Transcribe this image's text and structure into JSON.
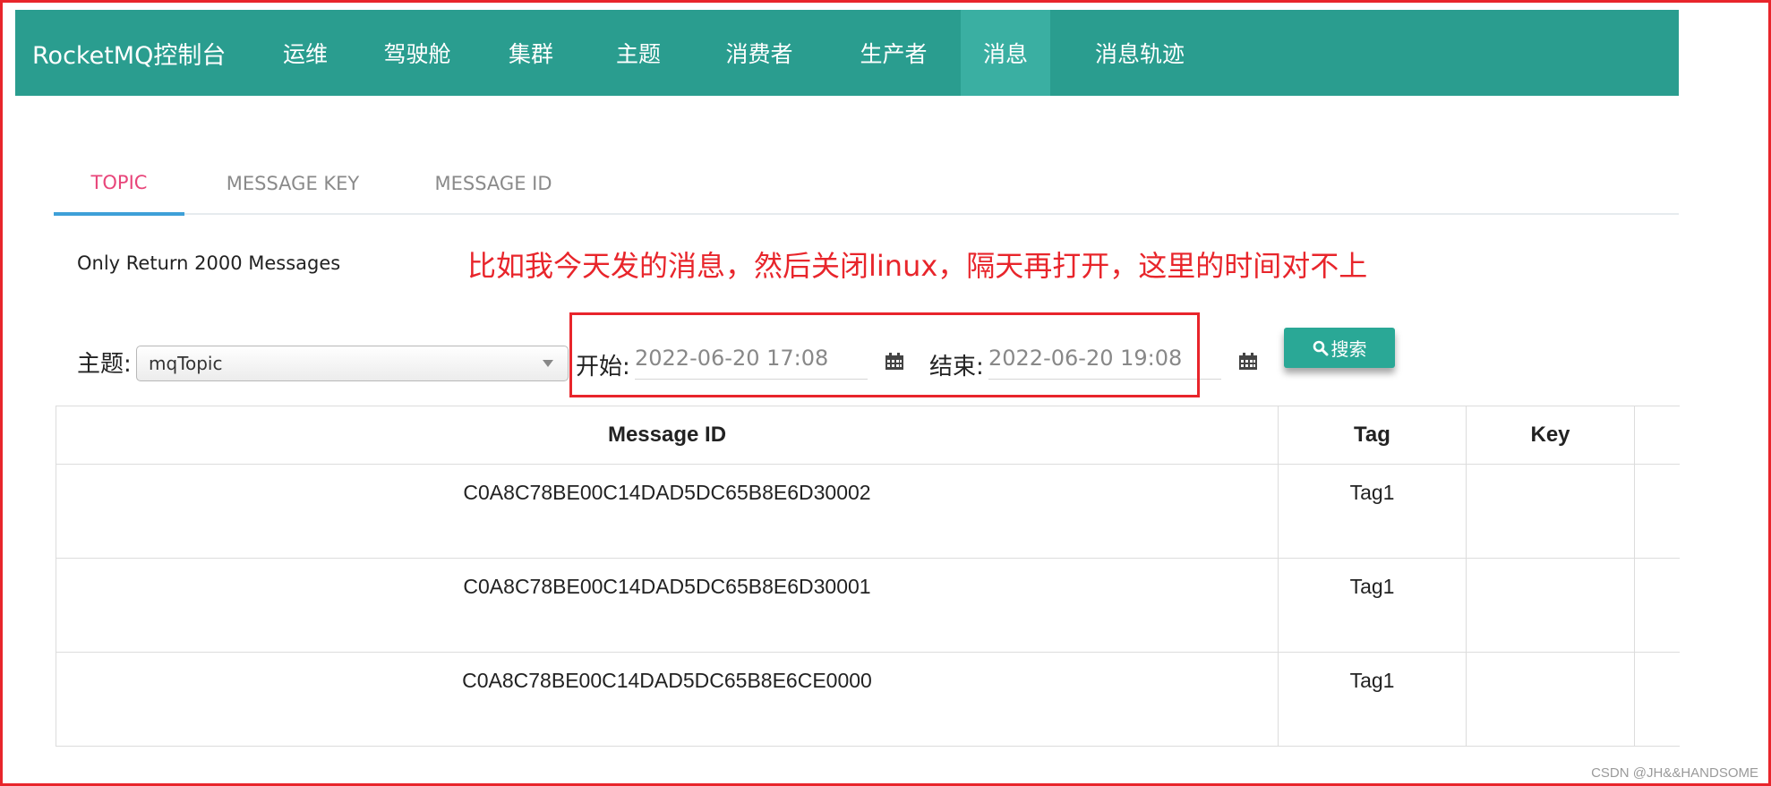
{
  "navbar": {
    "brand": "RocketMQ控制台",
    "items": [
      {
        "label": "运维"
      },
      {
        "label": "驾驶舱"
      },
      {
        "label": "集群"
      },
      {
        "label": "主题"
      },
      {
        "label": "消费者"
      },
      {
        "label": "生产者"
      },
      {
        "label": "消息",
        "active": true
      },
      {
        "label": "消息轨迹"
      }
    ]
  },
  "tabs": [
    {
      "label": "TOPIC",
      "active": true
    },
    {
      "label": "MESSAGE KEY"
    },
    {
      "label": "MESSAGE ID"
    }
  ],
  "info_text": "Only Return 2000 Messages",
  "annotation": "比如我今天发的消息，然后关闭linux，隔天再打开，这里的时间对不上",
  "filters": {
    "topic_label": "主题:",
    "topic_value": "mqTopic",
    "start_label": "开始:",
    "start_value": "2022-06-20 17:08",
    "end_label": "结束:",
    "end_value": "2022-06-20 19:08",
    "search_label": "搜索"
  },
  "table": {
    "headers": [
      "Message ID",
      "Tag",
      "Key",
      ""
    ],
    "rows": [
      [
        "C0A8C78BE00C14DAD5DC65B8E6D30002",
        "Tag1",
        "",
        ""
      ],
      [
        "C0A8C78BE00C14DAD5DC65B8E6D30001",
        "Tag1",
        "",
        ""
      ],
      [
        "C0A8C78BE00C14DAD5DC65B8E6CE0000",
        "Tag1",
        "",
        ""
      ]
    ]
  },
  "watermark": "CSDN @JH&&HANDSOME",
  "colors": {
    "navbar": "#2a9d8f",
    "nav_active": "#3aafa2",
    "tab_active_text": "#e8457a",
    "tab_underline": "#3ea0d8",
    "annotation": "#e8252b",
    "search_button": "#2aa896"
  },
  "icons": [
    "calendar-icon",
    "search-icon",
    "chevron-down-icon"
  ]
}
